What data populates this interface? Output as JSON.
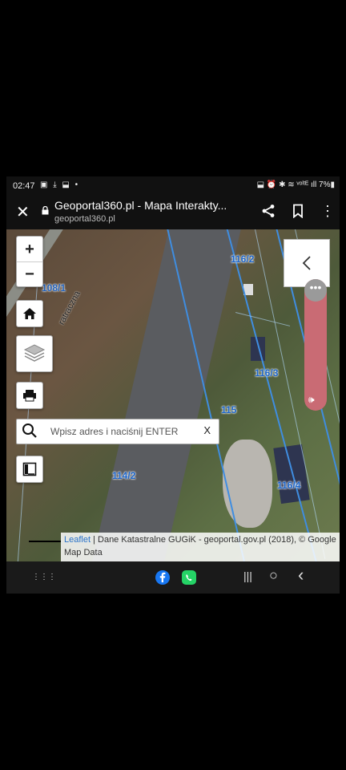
{
  "status_bar": {
    "time": "02:47",
    "left_icons": "▣ ⤓ ⬓ •",
    "right_icons": "⬓ ⏰  ✱ ≋ ᵛᵒˡᵗᴱ ıll 7%▮"
  },
  "browser": {
    "close_label": "✕",
    "title": "Geoportal360.pl - Mapa Interakty...",
    "url": "geoportal360.pl",
    "more_label": "⋮"
  },
  "map": {
    "zoom_in_label": "+",
    "zoom_out_label": "−",
    "search": {
      "placeholder": "Wpisz adres i naciśnij ENTER",
      "value": "",
      "clear_label": "X"
    },
    "street_label": "ratraczna",
    "parcels": [
      {
        "label": "116/2"
      },
      {
        "label": "116/3"
      },
      {
        "label": "115"
      },
      {
        "label": "114/2"
      },
      {
        "label": "116/4"
      },
      {
        "label": "108/1"
      }
    ],
    "sidebar_dots": "•••",
    "sidebar_audio": "🕪",
    "attribution": {
      "leaflet": "Leaflet",
      "text": " | Dane Katastralne GUGiK - geoportal.gov.pl (2018), © Google Map Data"
    }
  },
  "nav_bar": {
    "apps_label": "⋮⋮⋮",
    "recent_label": "|||",
    "home_label": "○",
    "back_label": "‹"
  },
  "colors": {
    "parcel_line": "#3f8de0",
    "parcel_label": "#1e66c9",
    "sidebar": "#c96b74",
    "facebook": "#1877f2",
    "whatsapp": "#25d366"
  }
}
